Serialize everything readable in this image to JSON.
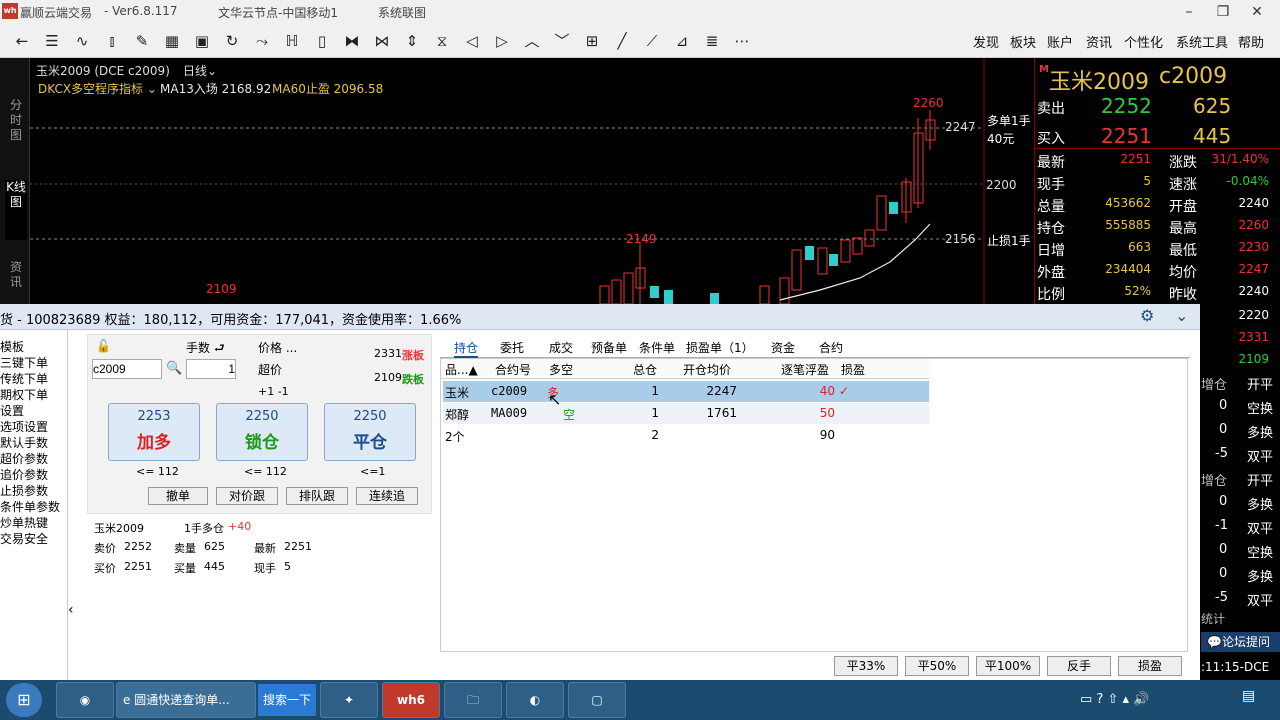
{
  "window": {
    "app": "赢顺云端交易",
    "version": "- Ver6.8.117",
    "node": "文华云节点-中国移动1",
    "mode": "系统联图"
  },
  "menu": [
    "发现",
    "板块",
    "账户",
    "资讯",
    "个性化",
    "系统工具",
    "帮助"
  ],
  "chart": {
    "symbol": "玉米2009 (DCE c2009)",
    "period": "日线",
    "indicator": "DKCX多空程序指标",
    "ma13": "MA13入场 2168.92",
    "ma60": "MA60止盈 2096.58",
    "high_label": "2260",
    "mid_label": "2149",
    "low_label": "2109",
    "long_tag": "多单1手",
    "long_sub": "40元",
    "stop_tag": "止损1手",
    "price_axis": [
      {
        "v": "2247"
      },
      {
        "v": "2200"
      },
      {
        "v": "2156"
      }
    ],
    "left_tabs": [
      "分时图",
      "K线图",
      "资讯"
    ]
  },
  "quote": {
    "title": "玉米2009",
    "code": "c2009",
    "sell": {
      "label": "卖出",
      "price": "2252",
      "vol": "625"
    },
    "buy": {
      "label": "买入",
      "price": "2251",
      "vol": "445"
    },
    "rows": [
      {
        "l1": "最新",
        "v1": "2251",
        "l2": "涨跌",
        "v2": "31/1.40%"
      },
      {
        "l1": "现手",
        "v1": "5",
        "l2": "速涨",
        "v2": "-0.04%"
      },
      {
        "l1": "总量",
        "v1": "453662",
        "l2": "开盘",
        "v2": "2240"
      },
      {
        "l1": "持仓",
        "v1": "555885",
        "l2": "最高",
        "v2": "2260"
      },
      {
        "l1": "日增",
        "v1": "663",
        "l2": "最低",
        "v2": "2230"
      },
      {
        "l1": "外盘",
        "v1": "234404",
        "l2": "均价",
        "v2": "2247"
      },
      {
        "l1": "比例",
        "v1": "52%",
        "l2": "昨收",
        "v2": "2240"
      }
    ],
    "extra": [
      "2220",
      "2331",
      "2109"
    ],
    "ticks1": [
      {
        "h": "增仓",
        "t": "开平"
      },
      {
        "n": "0",
        "t": "空换"
      },
      {
        "n": "0",
        "t": "多换"
      },
      {
        "n": "-5",
        "t": "双平"
      }
    ],
    "ticks2": [
      {
        "h": "增仓",
        "t": "开平"
      },
      {
        "n": "0",
        "t": "多换"
      },
      {
        "n": "-1",
        "t": "双平"
      },
      {
        "n": "0",
        "t": "空换"
      },
      {
        "n": "0",
        "t": "多换"
      },
      {
        "n": "-5",
        "t": "双平"
      }
    ],
    "stat": "统计",
    "forum": "论坛提问",
    "time": ":11:15-DCE"
  },
  "panel": {
    "header": "货 - 100823689  权益：180,112，可用资金：177,041，资金使用率：1.66%",
    "leftmenu": [
      "模板",
      "三键下单",
      "传统下单",
      "期权下单",
      "设置",
      "选项设置",
      "默认手数",
      "超价参数",
      "追价参数",
      "止损参数",
      "条件单参数",
      "炒单热键",
      "交易安全"
    ],
    "order": {
      "symbol": "c2009",
      "qty_label": "手数",
      "qty": "1",
      "price_label": "价格 ...",
      "price_mode": "超价",
      "up_limit": "2331",
      "up_label": "涨板",
      "down_limit": "2109",
      "down_label": "跌板",
      "adj": "+1  -1",
      "buy": {
        "price": "2253",
        "label": "加多",
        "limit": "<= 112"
      },
      "lock": {
        "price": "2250",
        "label": "锁仓",
        "limit": "<= 112"
      },
      "close": {
        "price": "2250",
        "label": "平仓",
        "limit": "<=1"
      },
      "actions": [
        "撤单",
        "对价跟",
        "排队跟",
        "连续追"
      ]
    },
    "info": {
      "name": "玉米2009",
      "pos": "1手多仓",
      "pnl": "+40",
      "ask_l": "卖价",
      "ask": "2252",
      "askv_l": "卖量",
      "askv": "625",
      "last_l": "最新",
      "last": "2251",
      "bid_l": "买价",
      "bid": "2251",
      "bidv_l": "买量",
      "bidv": "445",
      "cur_l": "现手",
      "cur": "5"
    },
    "tabs": [
      "持仓",
      "委托",
      "成交",
      "预备单",
      "条件单",
      "损盈单（1）",
      "资金",
      "合约"
    ],
    "cols": [
      "品...▲",
      "合约号",
      "多空",
      "总仓",
      "开仓均价",
      "逐笔浮盈",
      "损盈"
    ],
    "rows": [
      {
        "p": "玉米",
        "c": "c2009",
        "d": "多",
        "t": "1",
        "o": "2247",
        "f": "40"
      },
      {
        "p": "郑醇",
        "c": "MA009",
        "d": "空",
        "t": "1",
        "o": "1761",
        "f": "50"
      }
    ],
    "total": {
      "p": "2个",
      "t": "2",
      "f": "90"
    },
    "bottom": [
      "平33%",
      "平50%",
      "平100%",
      "反手",
      "损盈"
    ]
  },
  "taskbar": {
    "ie": "圆通快递查询单...",
    "search": "搜索一下",
    "wh": "wh6"
  }
}
